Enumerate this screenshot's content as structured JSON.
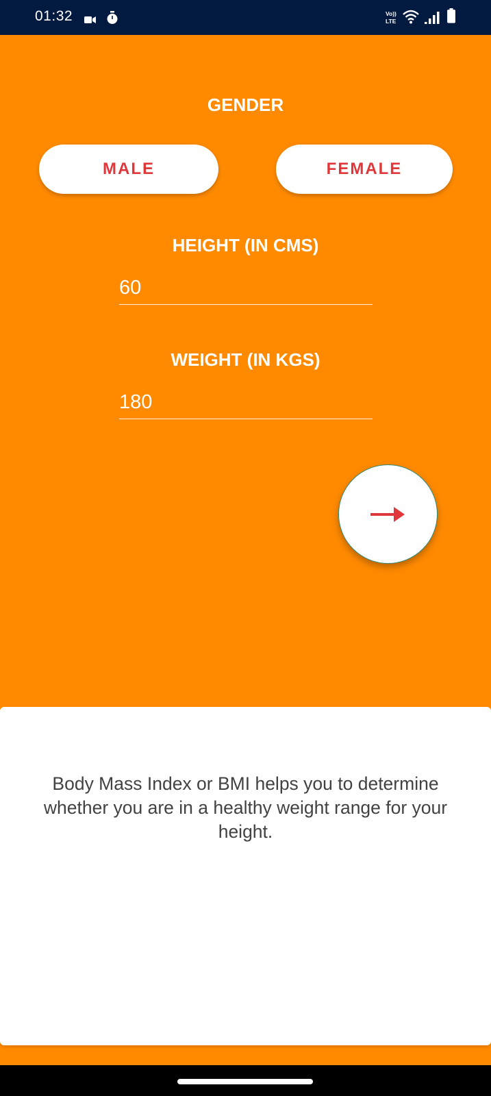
{
  "status_bar": {
    "time": "01:32",
    "volte_label": "Vo)) LTE",
    "icons": [
      "video-recording-icon",
      "stopwatch-icon",
      "volte-icon",
      "wifi-icon",
      "signal-icon",
      "battery-icon"
    ]
  },
  "gender": {
    "title": "GENDER",
    "male_label": "MALE",
    "female_label": "FEMALE"
  },
  "height": {
    "title": "HEIGHT (IN CMS)",
    "value": "60"
  },
  "weight": {
    "title": "WEIGHT (IN KGS)",
    "value": "180"
  },
  "next_button": {
    "icon": "arrow-right-icon"
  },
  "info": {
    "text": "Body Mass Index or BMI helps you to determine whether you are in a healthy weight range for your height."
  },
  "colors": {
    "background": "#FF8A00",
    "status_bar": "#031A40",
    "accent": "#E0373B",
    "card": "#FFFFFF"
  }
}
